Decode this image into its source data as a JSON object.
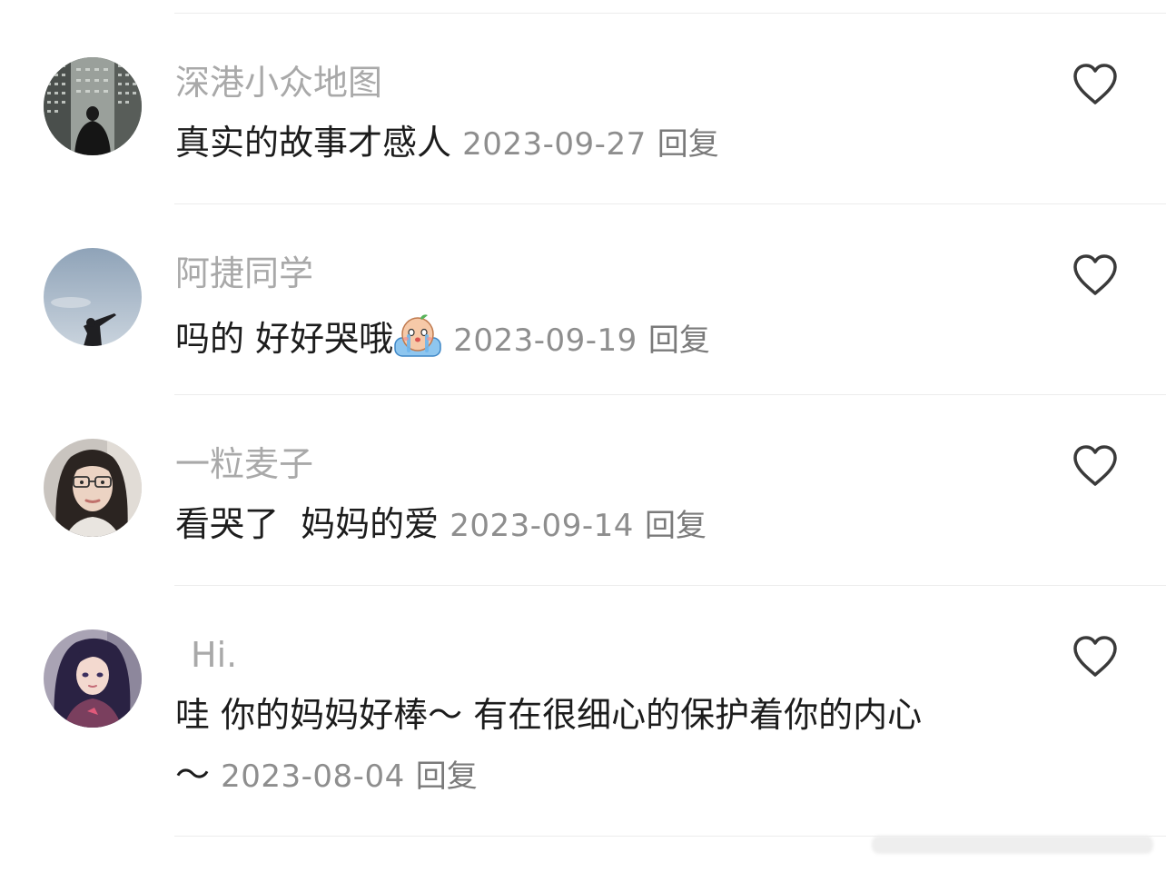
{
  "comments": [
    {
      "username": "深港小众地图",
      "text": "真实的故事才感人",
      "date": "2023-09-27",
      "reply_label": "回复",
      "avatar_icon": "avatar-city-buildings",
      "like_icon": "heart-outline-icon"
    },
    {
      "username": "阿捷同学",
      "text": "吗的 好好哭哦",
      "emoji": "crying-emoji",
      "date": "2023-09-19",
      "reply_label": "回复",
      "avatar_icon": "avatar-sky-silhouette",
      "like_icon": "heart-outline-icon"
    },
    {
      "username": "一粒麦子",
      "text": "看哭了  妈妈的爱",
      "date": "2023-09-14",
      "reply_label": "回复",
      "avatar_icon": "avatar-woman-glasses",
      "like_icon": "heart-outline-icon"
    },
    {
      "username": "Hi.",
      "text_line1": "哇 你的妈妈好棒～ 有在很细心的保护着你的内心",
      "text_line2": "～",
      "date": "2023-08-04",
      "reply_label": "回复",
      "avatar_icon": "avatar-anime-girl",
      "like_icon": "heart-outline-icon"
    }
  ],
  "colors": {
    "username": "#a9a9a9",
    "text": "#1c1c1c",
    "meta": "#8e8e8e",
    "divider": "#ececec"
  }
}
